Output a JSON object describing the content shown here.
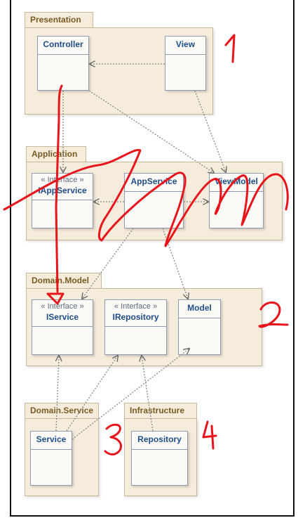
{
  "packages": {
    "presentation": "Presentation",
    "application": "Application",
    "domain_model": "Domain.Model",
    "domain_service": "Domain.Service",
    "infrastructure": "Infrastructure"
  },
  "classes": {
    "controller": {
      "name": "Controller"
    },
    "view": {
      "name": "View"
    },
    "iappservice": {
      "stereotype": "« Interface »",
      "name": "IAppService"
    },
    "appservice": {
      "name": "AppService"
    },
    "viewmodel": {
      "name": "ViewModel"
    },
    "iservice": {
      "stereotype": "« Interface »",
      "name": "IService"
    },
    "irepository": {
      "stereotype": "« Interface »",
      "name": "IRepository"
    },
    "model": {
      "name": "Model"
    },
    "service": {
      "name": "Service"
    },
    "repository": {
      "name": "Repository"
    }
  },
  "annotations": {
    "n1": "1",
    "n2": "2",
    "n3": "3",
    "n4": "4"
  },
  "colors": {
    "package_fill": "#f6ecdc",
    "package_title": "#7a5a22",
    "class_name": "#1f4d8a",
    "ink_red": "#e8141c"
  }
}
